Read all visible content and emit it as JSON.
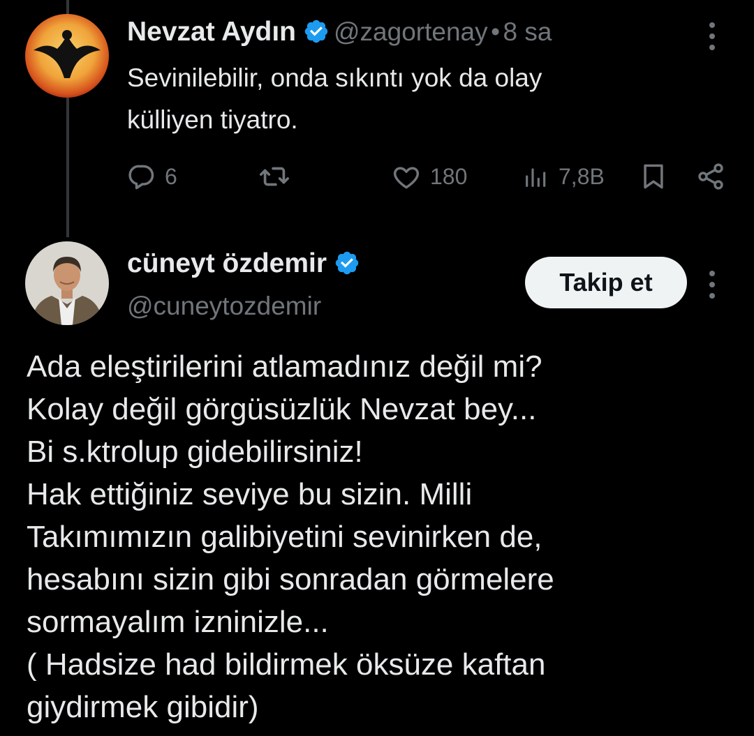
{
  "reply_tweet": {
    "author_name": "Nevzat Aydın",
    "handle": "@zagortenay",
    "separator": "•",
    "time": "8 sa",
    "text": "Sevinilebilir, onda sıkıntı yok da olay\nkülliyen tiyatro.",
    "actions": {
      "replies": "6",
      "retweets": "",
      "likes": "180",
      "views": "7,8B"
    },
    "icons": [
      "reply-icon",
      "retweet-icon",
      "like-icon",
      "views-icon",
      "bookmark-icon",
      "share-icon",
      "more-icon",
      "verified-icon"
    ]
  },
  "main_tweet": {
    "author_name": "cüneyt özdemir",
    "handle": "@cuneytozdemir",
    "follow_label": "Takip et",
    "text": "Ada eleştirilerini atlamadınız değil mi?\nKolay değil görgüsüzlük Nevzat bey...\nBi s.ktrolup gidebilirsiniz!\nHak ettiğiniz seviye bu sizin. Milli\nTakımımızın galibiyetini sevinirken de,\nhesabını sizin gibi sonradan görmelere\nsormayalım izninizle...\n( Hadsize had bildirmek öksüze kaftan\ngiydirmek gibidir)"
  },
  "colors": {
    "background": "#000000",
    "text": "#e7e9ea",
    "secondary": "#71767b",
    "verified": "#1d9bf0",
    "follow_button_bg": "#eff3f4"
  }
}
